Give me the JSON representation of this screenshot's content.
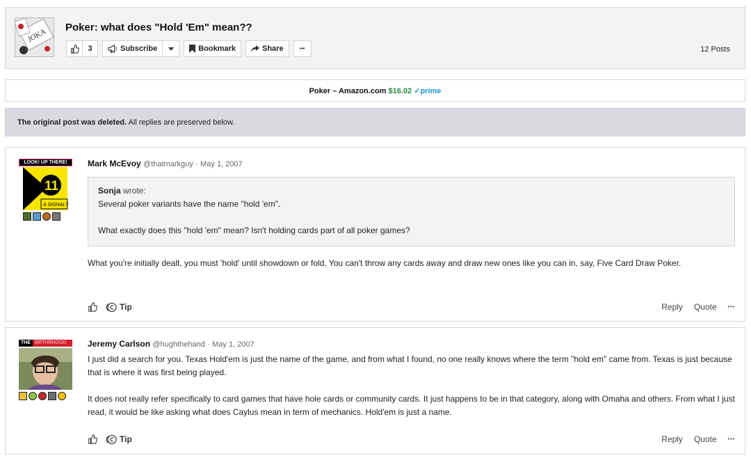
{
  "thread": {
    "title": "Poker: what does \"Hold 'Em\" mean??",
    "thumb_text": "JOKA",
    "like_count": "3",
    "subscribe_label": "Subscribe",
    "bookmark_label": "Bookmark",
    "share_label": "Share",
    "more_label": "•••",
    "posts_count": "12 Posts"
  },
  "ad": {
    "title": "Poker – Amazon.com",
    "price": "$16.02",
    "prime": "✓prime"
  },
  "notice": {
    "strong": "The original post was deleted.",
    "rest": "All replies are preserved below."
  },
  "posts": [
    {
      "badge_text": "LOOK! UP THERE!",
      "avatar_text": "11",
      "avatar_sub": "A SIGNAL?",
      "author": "Mark McEvoy",
      "handle": "@thatmarkguy",
      "dot": "·",
      "date": "May 1, 2007",
      "quote": {
        "author": "Sonja",
        "wrote": "wrote:",
        "line1": "Several poker variants have the name \"hold 'em\".",
        "line2": "What exactly does this \"hold 'em\" mean? Isn't holding cards part of all poker games?"
      },
      "text": "What you're initially dealt, you must 'hold' until showdown or fold. You can't throw any cards away and draw new ones like you can in, say, Five Card Draw Poker.",
      "tip_label": "Tip",
      "reply_label": "Reply",
      "quote_label": "Quote",
      "more_label": "•••"
    },
    {
      "badge_text_a": "THE",
      "badge_text_b": "BRTHRHOOD",
      "author": "Jeremy Carlson",
      "handle": "@hughthehand",
      "dot": "·",
      "date": "May 1, 2007",
      "text1": "I just did a search for you. Texas Hold'em is just the name of the game, and from what I found, no one really knows where the term \"hold em\" came from. Texas is just because that is where it was first being played.",
      "text2": "It does not really refer specifically to card games that have hole cards or community cards. It just happens to be in that category, along with Omaha and others. From what I just read, it would be like asking what does Caylus mean in term of mechanics. Hold'em is just a name.",
      "tip_label": "Tip",
      "reply_label": "Reply",
      "quote_label": "Quote",
      "more_label": "•••"
    }
  ],
  "colors": {
    "header_bg": "#f3f3f3",
    "notice_bg": "#d9d9e0",
    "price_green": "#1f8a3e",
    "prime_blue": "#1a98d5"
  },
  "icons": [
    "thumbs-up-icon",
    "megaphone-icon",
    "caret-down-icon",
    "bookmark-icon",
    "share-arrow-icon",
    "ellipsis-icon",
    "tip-coin-icon"
  ]
}
